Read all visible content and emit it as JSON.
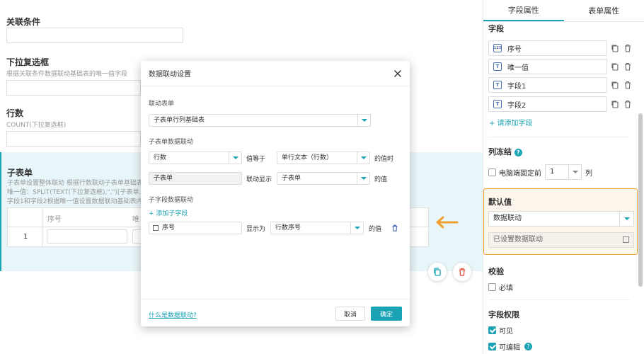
{
  "canvas": {
    "association": {
      "label": "关联条件"
    },
    "dropdown": {
      "label": "下拉复选框",
      "hint": "根据关联条件数据联动基础表的唯一值字段"
    },
    "rows": {
      "label": "行数",
      "hint": "COUNT(下拉复选框)"
    },
    "subtable": {
      "label": "子表单",
      "hint1": "子表单设置整体联动 根据行数联动子表单基础表",
      "hint2": "唯一值：SPLIT(TEXT(下拉复选框),\",\")[子表单.序",
      "hint3": "字段1和字段2根据唯一值设置数据联动基础表内",
      "col_seq": "序号",
      "col_unique": "唯",
      "row_num": "1"
    }
  },
  "modal": {
    "title": "数据联动设置",
    "linked_form_label": "联动表单",
    "linked_form_value": "子表单行列基础表",
    "subform_link_label": "子表单数据联动",
    "cond_field": "行数",
    "equals_text": "值等于",
    "cond_target": "单行文本（行数）",
    "when_text": "的值时",
    "display_field": "子表单",
    "display_text": "联动显示",
    "display_target": "子表单",
    "value_text": "的值",
    "subfield_link_label": "子字段数据联动",
    "add_subfield": "+ 添加子字段",
    "sub_field": "序号",
    "show_as_text": "显示为",
    "sub_target": "行数序号",
    "sub_value_text": "的值",
    "help_link": "什么是数据联动?",
    "cancel": "取消",
    "confirm": "确定"
  },
  "panel": {
    "tabs": [
      "字段属性",
      "表单属性"
    ],
    "fields_title": "字段",
    "fields": [
      {
        "icon": "123",
        "label": "序号"
      },
      {
        "icon": "T",
        "label": "唯一值"
      },
      {
        "icon": "T",
        "label": "字段1"
      },
      {
        "icon": "T",
        "label": "字段2"
      }
    ],
    "add_field": "+ 请添加字段",
    "freeze_title": "列冻结",
    "freeze_label": "电脑端固定前",
    "freeze_value": "1",
    "freeze_unit": "列",
    "default_title": "默认值",
    "default_value": "数据联动",
    "default_status": "已设置数据联动",
    "validate_title": "校验",
    "required_label": "必填",
    "permission_title": "字段权限",
    "visible_label": "可见",
    "editable_label": "可编辑"
  },
  "colors": {
    "accent": "#19a3b4",
    "highlight": "#f0a030",
    "danger": "#e74c3c"
  }
}
